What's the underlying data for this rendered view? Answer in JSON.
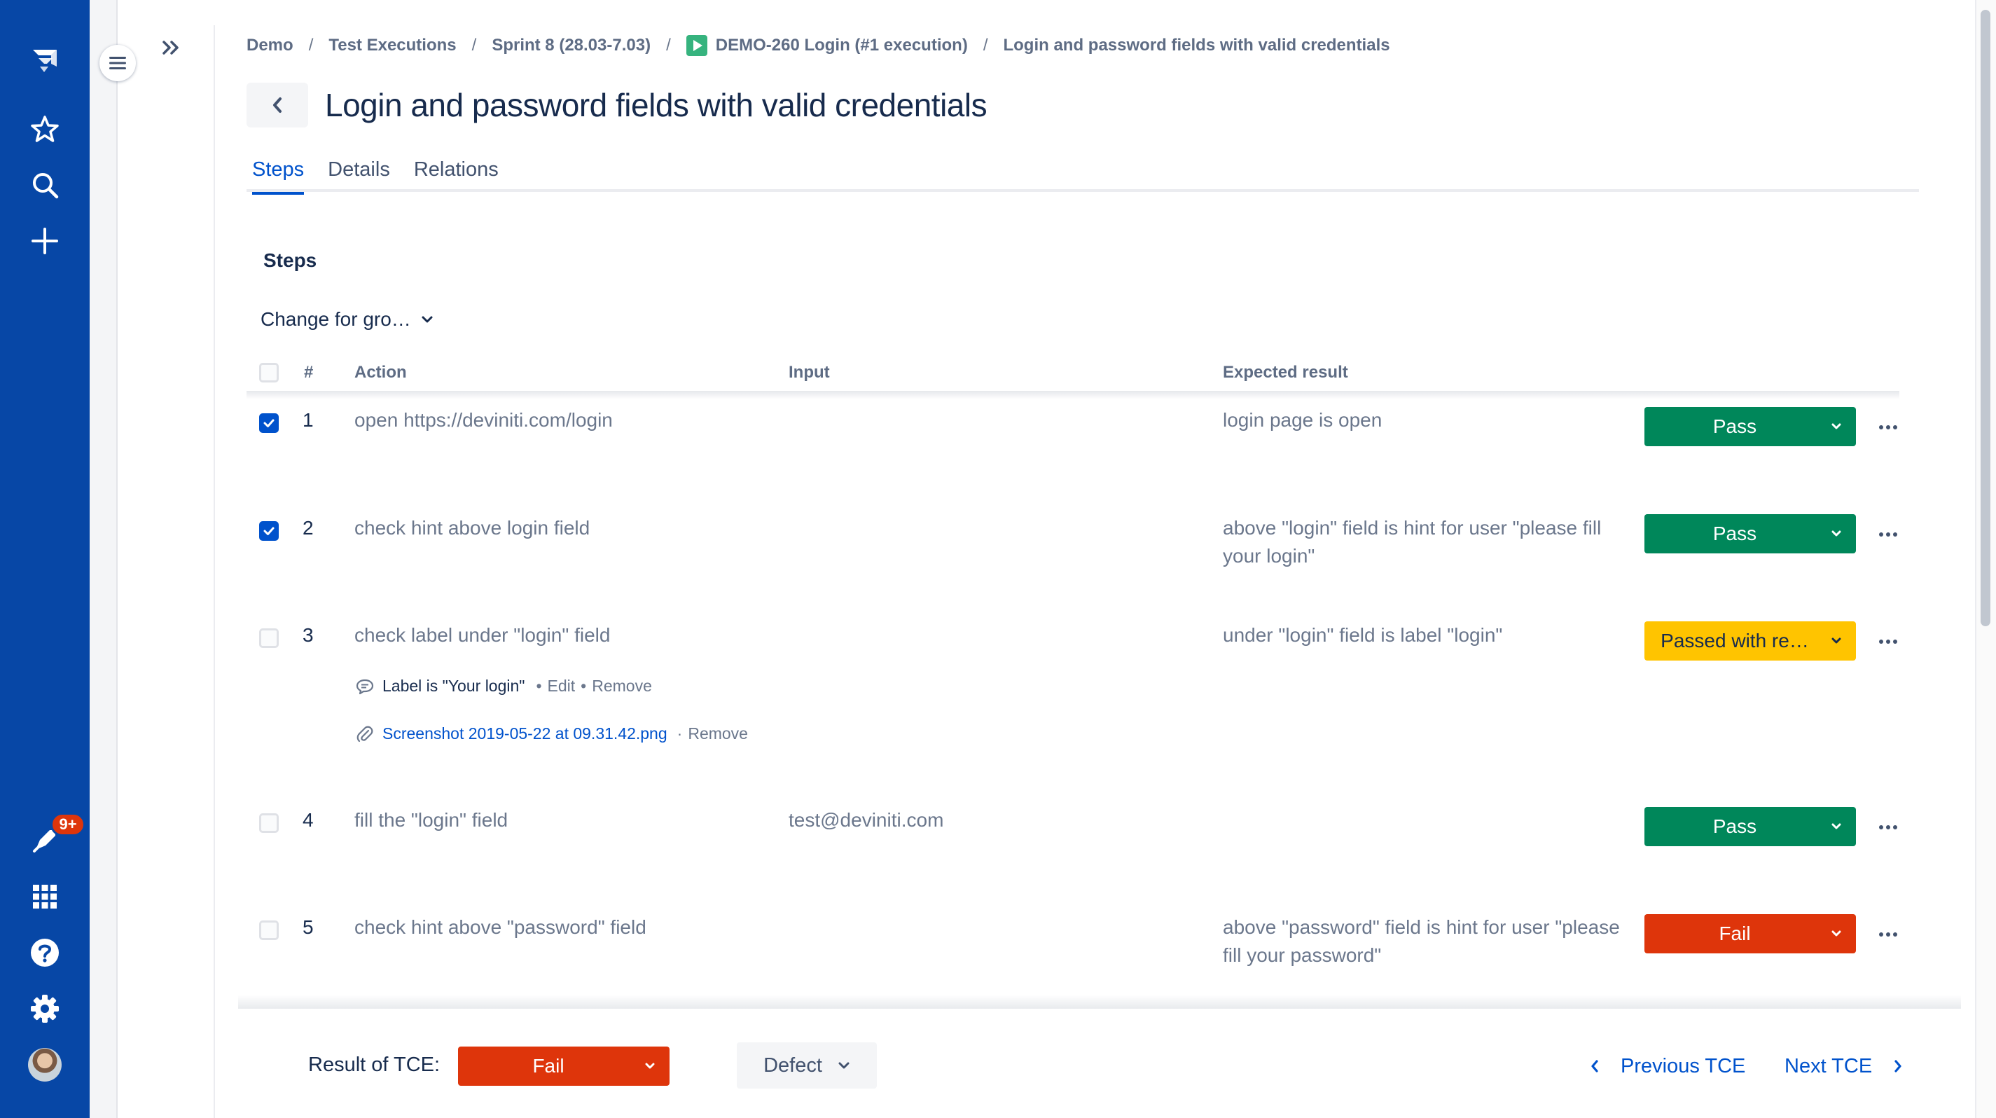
{
  "nav": {
    "notifications_badge": "9+"
  },
  "breadcrumbs": [
    "Demo",
    "Test Executions",
    "Sprint 8 (28.03-7.03)",
    "DEMO-260 Login (#1 execution)",
    "Login and password fields with valid credentials"
  ],
  "breadcrumb_separator": "/",
  "title": "Login and password fields with valid credentials",
  "tabs": [
    {
      "label": "Steps",
      "active": true
    },
    {
      "label": "Details",
      "active": false
    },
    {
      "label": "Relations",
      "active": false
    }
  ],
  "steps_section": {
    "heading": "Steps",
    "group_select": "Change for gro…",
    "columns": {
      "number": "#",
      "action": "Action",
      "input": "Input",
      "expected": "Expected result"
    },
    "rows": [
      {
        "num": "1",
        "action": "open https://deviniti.com/login",
        "input": "",
        "expected": "login page is open",
        "status": "Pass",
        "checked": true
      },
      {
        "num": "2",
        "action": "check hint above login field",
        "input": "",
        "expected": "above \"login\" field is hint for user \"please fill your login\"",
        "status": "Pass",
        "checked": true
      },
      {
        "num": "3",
        "action": "check label under \"login\" field",
        "input": "",
        "expected": "under \"login\" field is label \"login\"",
        "status": "Passed with re…",
        "checked": false,
        "comment": {
          "text": "Label is \"Your login\"",
          "edit": "Edit",
          "remove": "Remove"
        },
        "attachment": {
          "name": "Screenshot 2019-05-22 at 09.31.42.png",
          "remove": "Remove"
        }
      },
      {
        "num": "4",
        "action": "fill the \"login\" field",
        "input": "test@deviniti.com",
        "expected": "",
        "status": "Pass",
        "checked": false
      },
      {
        "num": "5",
        "action": "check hint above \"password\" field",
        "input": "",
        "expected": "above \"password\" field is hint for user \"please fill your password\"",
        "status": "Fail",
        "checked": false
      }
    ]
  },
  "footer": {
    "result_label": "Result of TCE:",
    "result_value": "Fail",
    "defect_label": "Defect",
    "previous_label": "Previous TCE",
    "next_label": "Next TCE"
  },
  "colors": {
    "global_nav": "#0747a6",
    "link": "#0052cc",
    "pass": "#00875a",
    "fail": "#de350b",
    "warning": "#ffc400"
  },
  "icons": {
    "nav": [
      "jira-logo-icon",
      "star-icon",
      "search-icon",
      "plus-icon",
      "rocket-icon",
      "app-switcher-icon",
      "help-icon",
      "settings-icon"
    ],
    "row": [
      "comment-icon",
      "attachment-icon",
      "more-icon",
      "chevron-down-icon"
    ]
  }
}
